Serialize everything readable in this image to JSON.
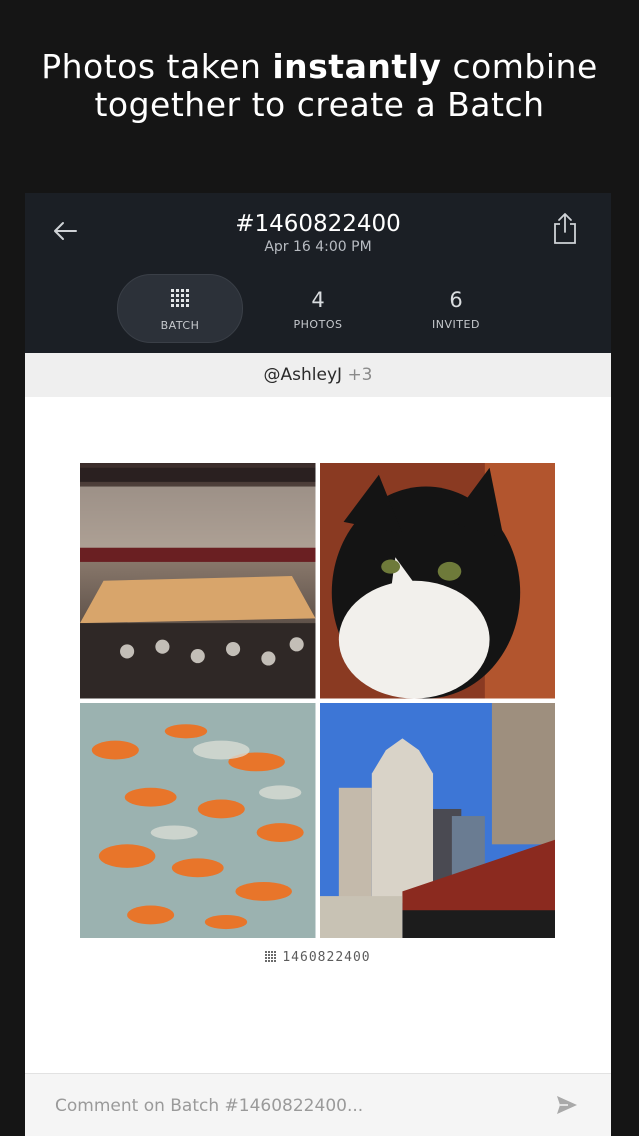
{
  "headline": {
    "part1": "Photos taken ",
    "bold": "instantly",
    "part2": " combine",
    "line2": "together to create a Batch"
  },
  "header": {
    "title": "#1460822400",
    "subtitle": "Apr 16 4:00 PM",
    "back_icon": "arrow-left-icon",
    "share_icon": "share-icon"
  },
  "tabs": [
    {
      "label": "BATCH",
      "icon": "grid-icon",
      "active": true
    },
    {
      "label": "PHOTOS",
      "count": "4"
    },
    {
      "label": "INVITED",
      "count": "6"
    }
  ],
  "userbar": {
    "user": "@AshleyJ",
    "extra": "+3"
  },
  "collage": {
    "photos": [
      {
        "alt": "basketball arena crowd"
      },
      {
        "alt": "black and white cat"
      },
      {
        "alt": "goldfish in tank"
      },
      {
        "alt": "city skyline with tower"
      }
    ],
    "label": "1460822400"
  },
  "comment": {
    "placeholder": "Comment on Batch #1460822400...",
    "send_icon": "send-icon"
  },
  "colors": {
    "topbar": "#1b1f25",
    "background": "#151515"
  }
}
